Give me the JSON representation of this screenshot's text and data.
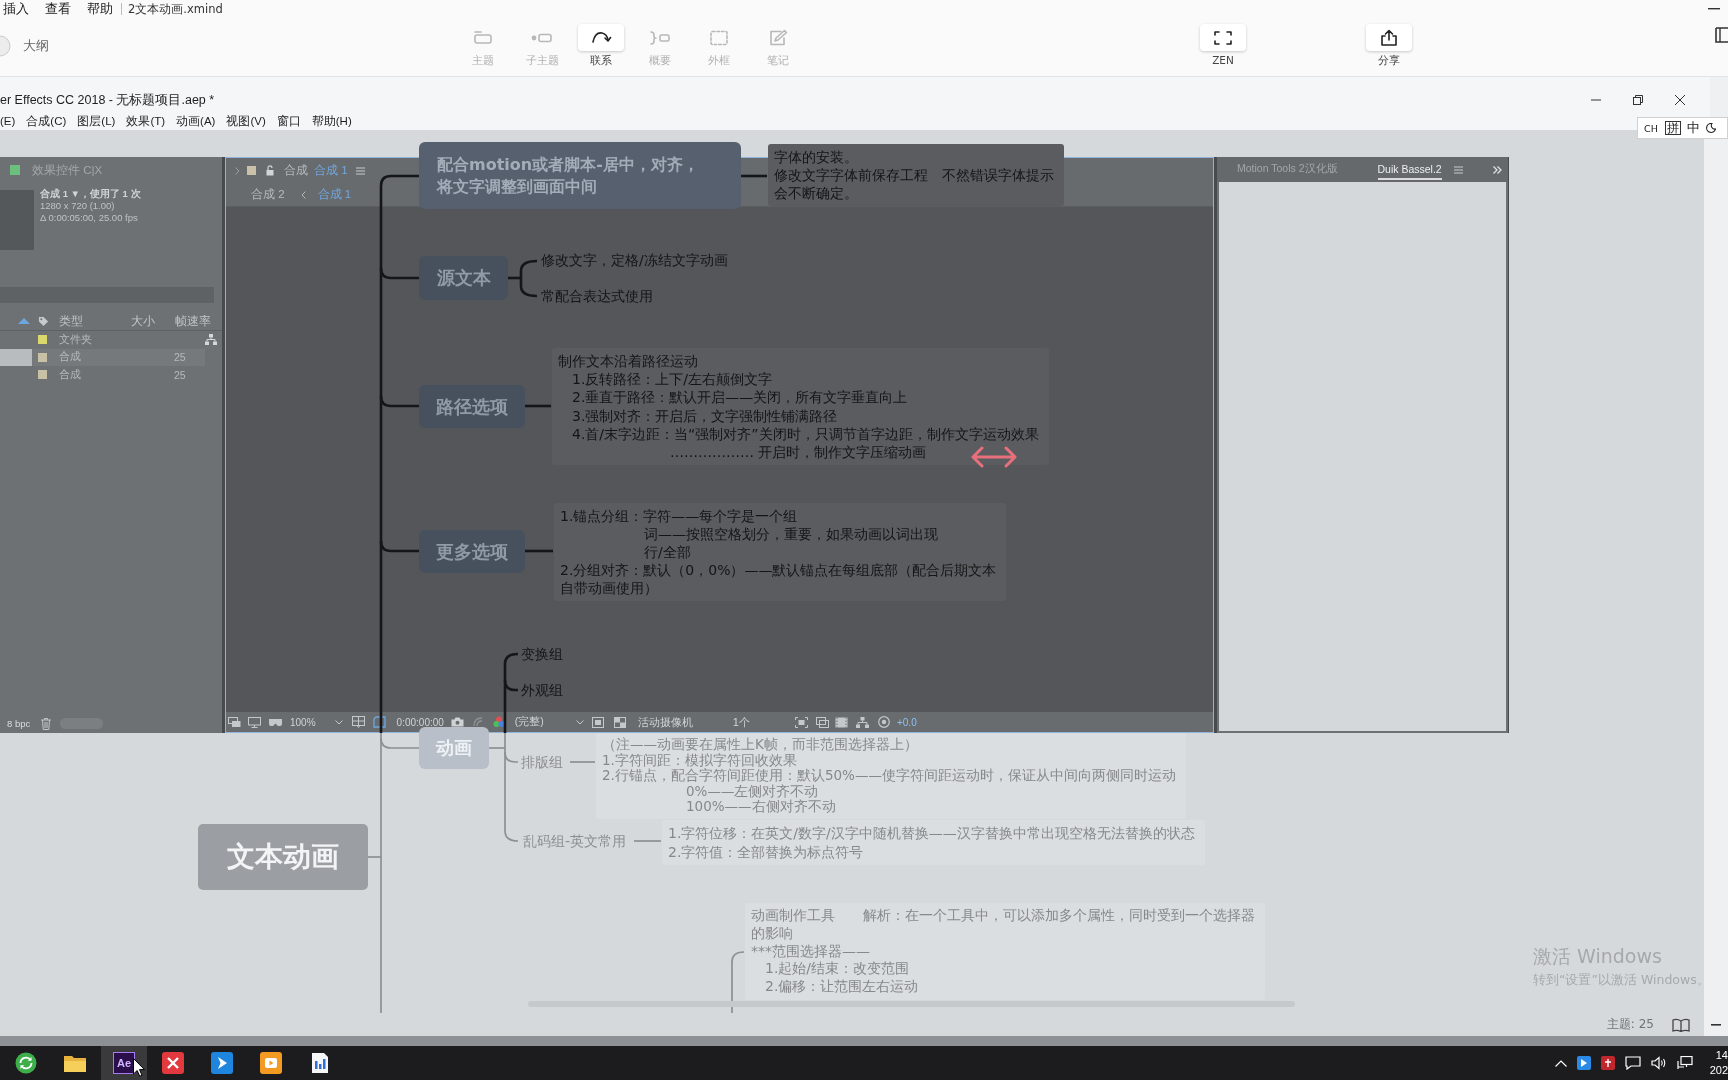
{
  "xmind": {
    "menu": [
      "插入",
      "查看",
      "帮助"
    ],
    "file_name": "2文本动画.xmind",
    "outline": "大纲",
    "toolbar": [
      {
        "label": "主题",
        "disabled": true
      },
      {
        "label": "子主题",
        "disabled": true
      },
      {
        "label": "联系",
        "disabled": false
      },
      {
        "label": "概要",
        "disabled": true
      },
      {
        "label": "外框",
        "disabled": true
      },
      {
        "label": "笔记",
        "disabled": true
      },
      {
        "label": "ZEN",
        "disabled": false
      },
      {
        "label": "分享",
        "disabled": false
      }
    ],
    "status": "主题: 25"
  },
  "after_effects": {
    "title": "er Effects CC 2018 - 无标题项目.aep *",
    "menu": [
      "(E)",
      "合成(C)",
      "图层(L)",
      "效果(T)",
      "动画(A)",
      "视图(V)",
      "窗口",
      "帮助(H)"
    ],
    "effects_panel": {
      "tab": "效果控件 C|X",
      "comp_info": [
        "合成 1 ▼，使用了 1 次",
        "1280 x 720 (1.00)",
        "Δ 0:00:05:00, 25.00 fps"
      ],
      "columns": [
        "类型",
        "大小",
        "帧速率"
      ],
      "items": [
        {
          "type": "文件夹",
          "color": "#d9d86c",
          "selected": false
        },
        {
          "type": "合成",
          "frame_rate": "25",
          "color": "#c8c1a6",
          "selected": true
        },
        {
          "type": "合成",
          "frame_rate": "25",
          "color": "#c8c1a6",
          "selected": false
        }
      ],
      "bit_depth": "8 bpc"
    },
    "composition": {
      "tab_label": "合成",
      "tab_name": "合成 1",
      "breadcrumbs": [
        {
          "label": "合成 2",
          "selected": false
        },
        {
          "label": "合成 1",
          "selected": true
        }
      ],
      "zoom": "100%",
      "timecode": "0:00:00:00",
      "resolution": "(完整)",
      "camera": "活动摄像机",
      "views": "1个",
      "exposure": "+0.0"
    },
    "side_panel": {
      "tabs": [
        {
          "label": "Motion Tools 2汉化版",
          "selected": false
        },
        {
          "label": "Duik Bassel.2",
          "selected": true
        }
      ]
    }
  },
  "ime_bar": {
    "items": [
      "CH",
      "拼",
      "中"
    ]
  },
  "mind_map": {
    "root": "文本动画",
    "topics": [
      {
        "label": "配合motion或者脚本-居中，对齐，将文字调整到画面中间",
        "children": [
          {
            "kind": "note",
            "lines": [
              "字体的安装。",
              "修改文字字体前保存工程　不然错误字体提示",
              "会不断确定。"
            ]
          }
        ]
      },
      {
        "label": "源文本",
        "children": [
          {
            "kind": "topic",
            "label": "修改文字，定格/冻结文字动画"
          },
          {
            "kind": "topic",
            "label": "常配合表达式使用"
          }
        ]
      },
      {
        "label": "路径选项",
        "children": [
          {
            "kind": "note",
            "lines": [
              "制作文本沿着路径运动",
              "　1.反转路径：上下/左右颠倒文字",
              "　2.垂直于路径：默认开启——关闭，所有文字垂直向上",
              "　3.强制对齐：开启后，文字强制性铺满路径",
              "　4.首/末字边距：当“强制对齐”关闭时，只调节首字边距，制作文字运动效果",
              "　　　　　　　　……………… 开启时，制作文字压缩动画"
            ]
          }
        ]
      },
      {
        "label": "更多选项",
        "children": [
          {
            "kind": "note",
            "lines": [
              "1.锚点分组：字符——每个字是一个组",
              "　　　　　　词——按照空格划分，重要，如果动画以词出现",
              "　　　　　　行/全部",
              "2.分组对齐：默认（0，0%）——默认锚点在每组底部（配合后期文本",
              "自带动画使用）"
            ]
          }
        ]
      },
      {
        "label": "动画",
        "children": [
          {
            "kind": "topic",
            "label": "变换组"
          },
          {
            "kind": "topic",
            "label": "外观组"
          },
          {
            "kind": "topic",
            "label": "排版组",
            "children": [
              {
                "kind": "note",
                "lines": [
                  "（注——动画要在属性上K帧，而非范围选择器上）",
                  "1.字符间距：模拟字符回收效果",
                  "2.行锚点，配合字符间距使用：默认50%——使字符间距运动时，保证从中间向两侧同时运动",
                  "　　　　　　0%——左侧对齐不动",
                  "　　　　　　100%——右侧对齐不动"
                ]
              }
            ]
          },
          {
            "kind": "topic",
            "label": "乱码组-英文常用",
            "children": [
              {
                "kind": "note",
                "lines": [
                  "1.字符位移：在英文/数字/汉字中随机替换——汉字替换中常出现空格无法替换的状态",
                  "2.字符值：全部替换为标点符号"
                ]
              }
            ]
          }
        ]
      }
    ],
    "lower_note": {
      "lines": [
        "动画制作工具　　解析：在一个工具中，可以添加多个属性，同时受到一个选择器",
        "的影响",
        "***范围选择器——",
        "　1.起始/结束：改变范围",
        "　2.偏移：让范围左右运动"
      ]
    }
  },
  "activation_notice": {
    "title": "激活 Windows",
    "hint": "转到“设置”以激活 Windows。"
  },
  "taskbar": {
    "apps": [
      {
        "active": false
      },
      {
        "active": false
      },
      {
        "active": true,
        "label": "Ae"
      },
      {
        "active": false
      },
      {
        "active": false
      },
      {
        "active": false
      },
      {
        "active": false
      }
    ],
    "time": "14",
    "date": "202"
  }
}
